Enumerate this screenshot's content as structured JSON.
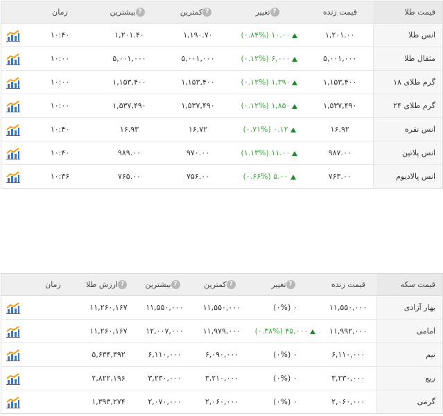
{
  "gold": {
    "headers": {
      "name": "قیمت طلا",
      "price": "قیمت زنده",
      "change": "تغییر",
      "low": "کمترین",
      "high": "بیشترین",
      "time": "زمان"
    },
    "rows": [
      {
        "name": "انس طلا",
        "price": "۱,۲۰۱.۰۰",
        "change": "۱۰.۰۰ (۰.۸۴%)",
        "low": "۱,۱۹۰.۷۰",
        "high": "۱,۲۰۱.۴۰",
        "time": "۱۰:۴۰"
      },
      {
        "name": "مثقال طلا",
        "price": "۵,۰۰۱,۰۰۰",
        "change": "۶,۰۰۰ (۰.۱۲%)",
        "low": "۵,۰۰۱,۰۰۰",
        "high": "۵,۰۰۱,۰۰۰",
        "time": "۱۰:۰۰"
      },
      {
        "name": "گرم طلای ۱۸",
        "price": "۱,۱۵۳,۴۰۰",
        "change": "۱,۳۹۰ (۰.۱۲%)",
        "low": "۱,۱۵۳,۴۰۰",
        "high": "۱,۱۵۳,۴۰۰",
        "time": "۱۰:۰۰"
      },
      {
        "name": "گرم طلای ۲۴",
        "price": "۱,۵۳۷,۴۹۰",
        "change": "۱,۸۵۰ (۰.۱۲%)",
        "low": "۱,۵۳۷,۴۹۰",
        "high": "۱,۵۳۷,۴۹۰",
        "time": "۱۰:۰۰"
      },
      {
        "name": "انس نقره",
        "price": "۱۶.۹۲",
        "change": "۰.۱۲ (۰.۷۱%)",
        "low": "۱۶.۷۲",
        "high": "۱۶.۹۳",
        "time": "۱۰:۴۰"
      },
      {
        "name": "انس پلاتین",
        "price": "۹۸۷.۰۰",
        "change": "۱۱.۰۰ (۱.۱۳%)",
        "low": "۹۷۰.۰۰",
        "high": "۹۸۹.۰۰",
        "time": "۱۰:۴۰"
      },
      {
        "name": "انس پالادیوم",
        "price": "۷۶۳.۰۰",
        "change": "۵.۰۰ (۰.۶۶%)",
        "low": "۷۵۶.۰۰",
        "high": "۷۶۵.۰۰",
        "time": "۱۰:۳۶"
      }
    ]
  },
  "coin": {
    "headers": {
      "name": "قیمت سکه",
      "price": "قیمت زنده",
      "change": "تغییر",
      "low": "کمترین",
      "high": "بیشترین",
      "value": "ارزش طلا",
      "time": "زمان"
    },
    "rows": [
      {
        "name": "بهار آزادی",
        "price": "۱۱,۵۵۰,۰۰۰",
        "change": "۰ (۰%)",
        "up": false,
        "low": "۱۱,۵۵۰,۰۰۰",
        "high": "۱۱,۵۵۰,۰۰۰",
        "value": "۱۱,۲۶۰,۱۶۷"
      },
      {
        "name": "امامی",
        "price": "۱۱,۹۹۲,۰۰۰",
        "change": "۴۵,۰۰۰ (۰.۳۸%)",
        "up": true,
        "low": "۱۱,۹۷۹,۰۰۰",
        "high": "۱۲,۰۰۷,۰۰۰",
        "value": "۱۱,۲۶۰,۱۶۷"
      },
      {
        "name": "نیم",
        "price": "۶,۱۱۰,۰۰۰",
        "change": "۰ (۰%)",
        "up": false,
        "low": "۶,۰۹۰,۰۰۰",
        "high": "۶,۱۱۰,۰۰۰",
        "value": "۵,۶۳۴,۳۹۲"
      },
      {
        "name": "ربع",
        "price": "۳,۲۳۰,۰۰۰",
        "change": "۰ (۰%)",
        "up": false,
        "low": "۳,۲۱۰,۰۰۰",
        "high": "۳,۲۳۰,۰۰۰",
        "value": "۲,۸۲۲,۱۹۶"
      },
      {
        "name": "گرمی",
        "price": "۲,۰۶۰,۰۰۰",
        "change": "۰ (۰%)",
        "up": false,
        "low": "۲,۰۶۰,۰۰۰",
        "high": "۲,۰۷۰,۰۰۰",
        "value": "۱,۳۹۳,۲۷۴"
      }
    ]
  },
  "icons": {
    "help": "question-mark-icon",
    "chart": "chart-icon",
    "up": "up-triangle-icon"
  },
  "colors": {
    "up": "#3aa63a",
    "triangle": "#1e8a2e",
    "chart_line": "#f39c12",
    "chart_bar": "#3a78c3"
  }
}
